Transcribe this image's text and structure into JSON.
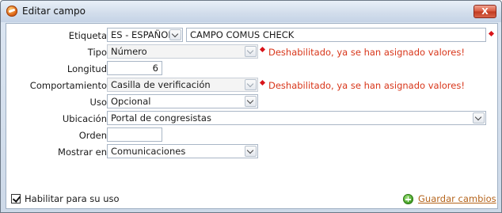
{
  "window": {
    "title": "Editar campo",
    "close_label": "X"
  },
  "form": {
    "etiqueta": {
      "label": "Etiqueta",
      "language": "ES - ESPAÑOL",
      "value": "CAMPO COMUS CHECK"
    },
    "tipo": {
      "label": "Tipo",
      "value": "Número",
      "warning": "Deshabilitado,  ya se han asignado valores!"
    },
    "longitud": {
      "label": "Longitud",
      "value": "6"
    },
    "comportamiento": {
      "label": "Comportamiento",
      "value": "Casilla de verificación",
      "warning": "Deshabilitado,  ya se han asignado valores!"
    },
    "uso": {
      "label": "Uso",
      "value": "Opcional"
    },
    "ubicacion": {
      "label": "Ubicación",
      "value": "Portal de congresistas"
    },
    "orden": {
      "label": "Orden",
      "value": ""
    },
    "mostrar_en": {
      "label": "Mostrar en",
      "value": "Comunicaciones"
    }
  },
  "footer": {
    "enable_label": "Habilitar para su uso",
    "enable_checked": true,
    "save_label": "Guardar cambios"
  },
  "colors": {
    "warning": "#d8361a",
    "required_marker": "#d8141a",
    "link": "#b5651d"
  }
}
